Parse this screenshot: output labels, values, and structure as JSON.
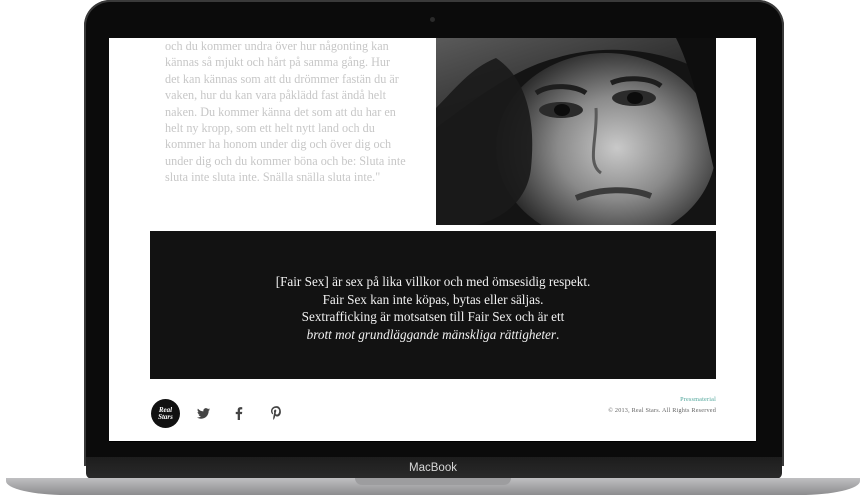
{
  "device": {
    "label": "MacBook"
  },
  "quote": {
    "lines": [
      "och du kommer undra över hur någonting kan",
      "kännas så mjukt och hårt på samma gång. Hur",
      "det kan kännas som att du drömmer fastän du är",
      "vaken, hur du kan vara påklädd fast ändå helt",
      "naken. Du kommer känna det som att du har en",
      "helt ny kropp, som ett helt nytt land och du",
      "kommer ha honom under dig och över dig och",
      "under dig och du kommer böna och be: Sluta inte",
      "sluta inte sluta inte. Snälla snälla sluta inte.\""
    ]
  },
  "banner": {
    "line1": "[Fair Sex] är sex på lika villkor och med ömsesidig respekt.",
    "line2": "Fair Sex kan inte köpas, bytas eller säljas.",
    "line3": "Sextrafficking är motsatsen till Fair Sex och är ett",
    "line4": "brott mot grundläggande mänskliga rättigheter",
    "line4_end": "."
  },
  "footer": {
    "logo_text": "Real\nStars",
    "social": [
      {
        "icon": "twitter-icon"
      },
      {
        "icon": "facebook-icon"
      },
      {
        "icon": "pinterest-icon"
      }
    ],
    "pressmaterial": "Pressmaterial",
    "copyright": "© 2013, Real Stars. All Rights Reserved"
  },
  "colors": {
    "banner_bg": "#121212",
    "link": "#4fa59a",
    "quote_text": "#c7c7c7"
  }
}
